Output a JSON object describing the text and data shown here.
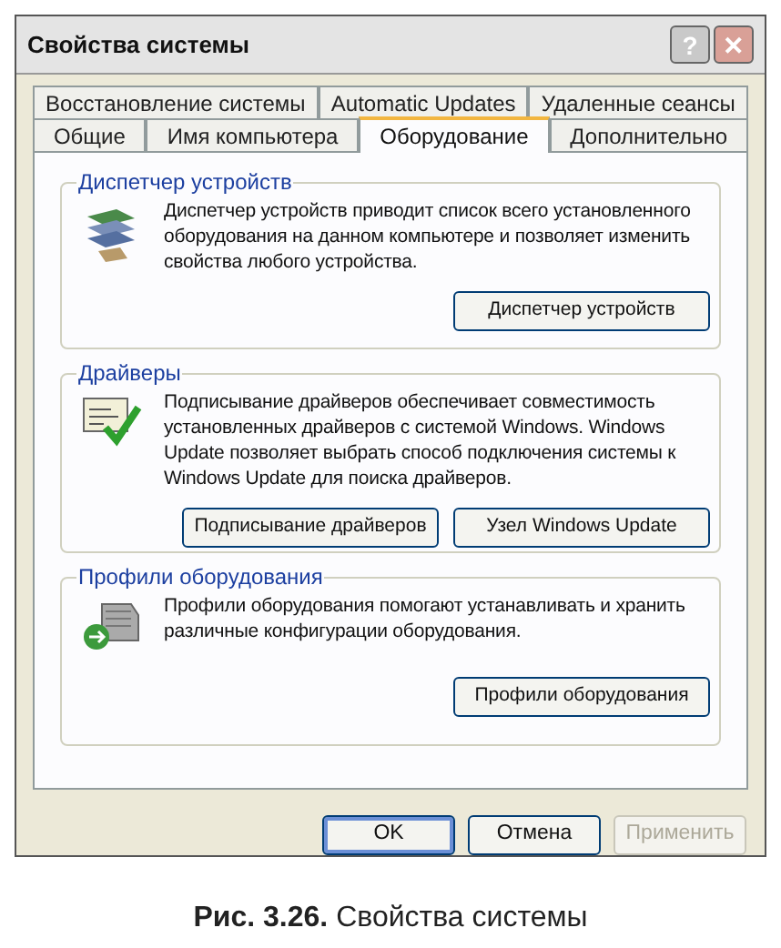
{
  "window": {
    "title": "Свойства системы"
  },
  "title_buttons": [
    {
      "kind": "help",
      "label": "?"
    },
    {
      "kind": "close",
      "label": "✕"
    }
  ],
  "tab_rows": [
    [
      {
        "label": "Восстановление системы",
        "selected": false
      },
      {
        "label": "Automatic Updates",
        "selected": false
      },
      {
        "label": "Удаленные сеансы",
        "selected": false
      }
    ],
    [
      {
        "label": "Общие",
        "selected": false
      },
      {
        "label": "Имя компьютера",
        "selected": false
      },
      {
        "label": "Оборудование",
        "selected": true
      },
      {
        "label": "Дополнительно",
        "selected": false
      }
    ]
  ],
  "groups": [
    {
      "title": "Диспетчер устройств",
      "text": "Диспетчер устройств приводит список всего установленного оборудования на данном компьютере и позволяет изменить свойства любого устройства.",
      "buttons": [
        "Диспетчер устройств"
      ]
    },
    {
      "title": "Драйверы",
      "text": "Подписывание драйверов обеспечивает совместимость установленных драйверов с системой Windows.  Windows Update позволяет выбрать способ подключения системы к Windows Update для поиска драйверов.",
      "buttons": [
        "Подписывание драйверов",
        "Узел Windows Update"
      ]
    },
    {
      "title": "Профили оборудования",
      "text": "Профили оборудования помогают устанавливать и хранить различные конфигурации оборудования.",
      "buttons": [
        "Профили оборудования"
      ]
    }
  ],
  "dialog_buttons": [
    {
      "label": "OK",
      "default": true,
      "disabled": false
    },
    {
      "label": "Отмена",
      "default": false,
      "disabled": false
    },
    {
      "label": "Применить",
      "default": false,
      "disabled": true
    }
  ],
  "caption": "**Рис. 3.26.** Свойства системы"
}
